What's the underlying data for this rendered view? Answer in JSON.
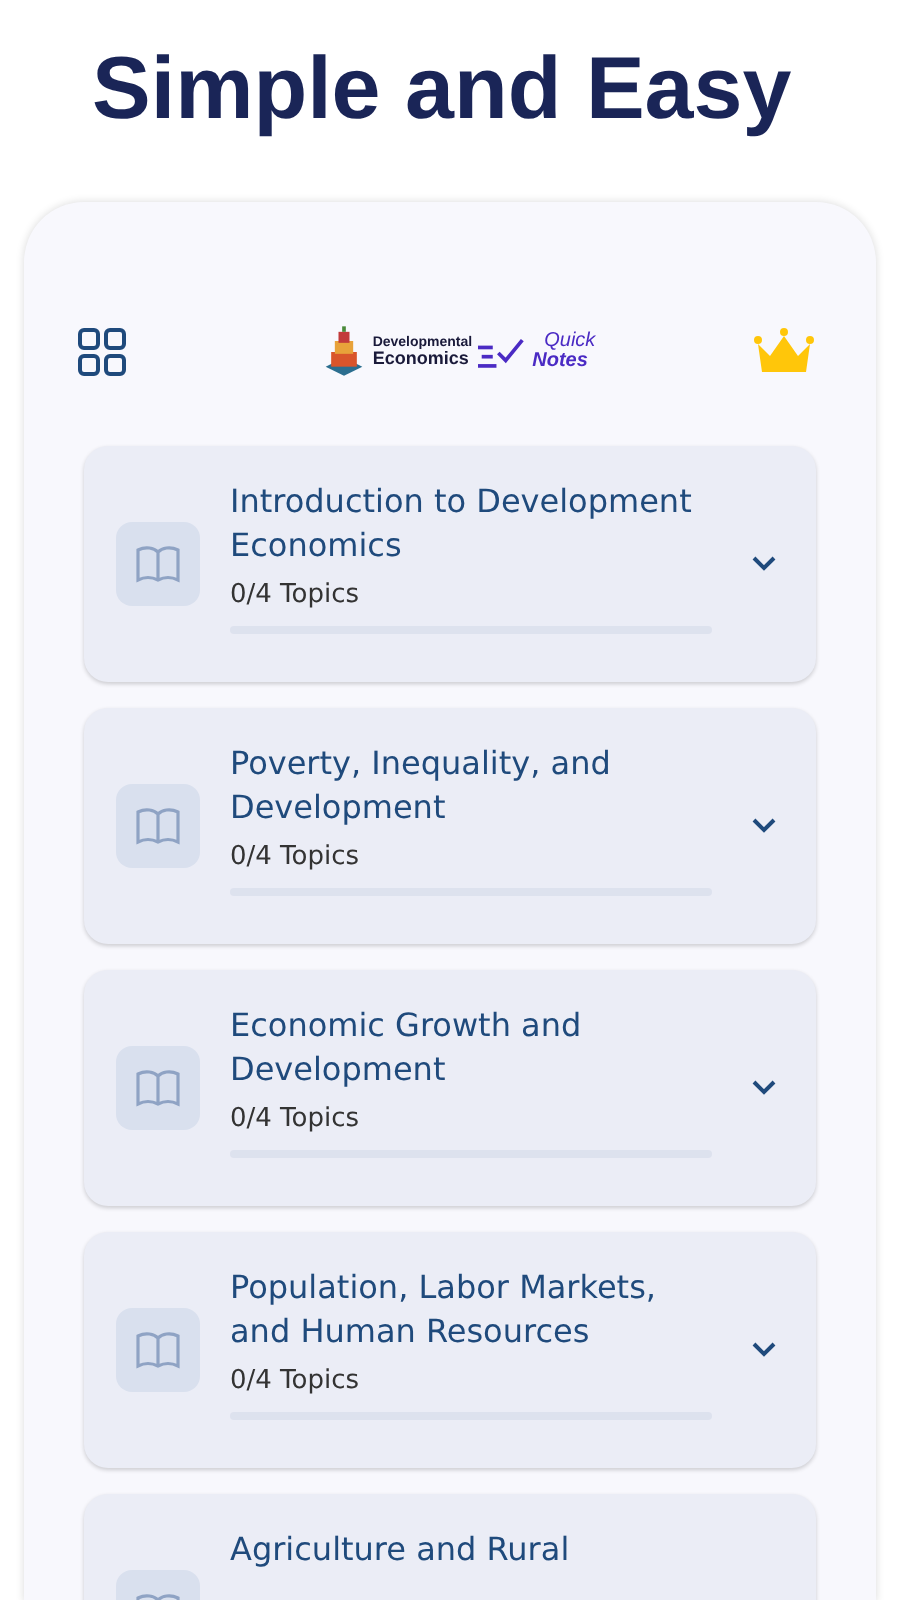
{
  "headline": "Simple and Easy",
  "header": {
    "logo": {
      "line_1": "Developmental",
      "line_2": "Economics"
    },
    "badge": {
      "line_1": "Quick",
      "line_2": "Notes"
    }
  },
  "chapters": [
    {
      "title": "Introduction to Development Economics",
      "progress": "0/4 Topics",
      "level": 0,
      "expanded": false
    },
    {
      "title": "Poverty, Inequality, and Development",
      "progress": "0/4 Topics",
      "level": 0,
      "expanded": false
    },
    {
      "title": "Economic Growth and Development",
      "progress": "0/4 Topics",
      "level": 0,
      "expanded": false
    },
    {
      "title": "Population, Labor Markets, and Human Resources",
      "progress": "0/4 Topics",
      "level": 0,
      "expanded": false
    },
    {
      "title": "Agriculture and Rural"
    }
  ]
}
